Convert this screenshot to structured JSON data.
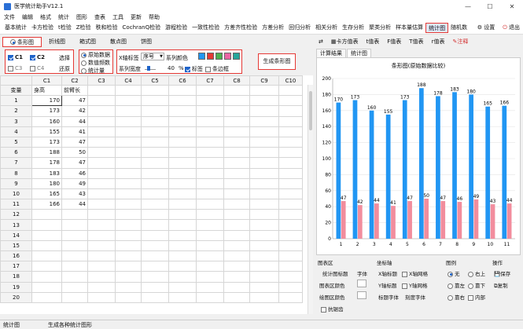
{
  "title": "医学统计助手V12.1",
  "menu": [
    "文件",
    "编辑",
    "格式",
    "统计",
    "图形",
    "查表",
    "工具",
    "更新",
    "帮助"
  ],
  "toolbar": [
    "基本统计",
    "卡方检验",
    "t检验",
    "Z检验",
    "秩和检验",
    "CochranQ检验",
    "游程检验",
    "一致性检验",
    "方差齐性检验",
    "方差分析",
    "回归分析",
    "相关分析",
    "生存分析",
    "聚类分析",
    "样本量估算",
    "统计图",
    "随机数"
  ],
  "toolbar_right": {
    "settings": "设置",
    "exit": "退出"
  },
  "chart_tabs": {
    "items": [
      "条形图",
      "折线图",
      "箱式图",
      "散点图",
      "饼图"
    ]
  },
  "cols": {
    "c1": "C1",
    "c2": "C2",
    "c3": "C3",
    "c4": "C4",
    "select": "选择",
    "restore": "还原"
  },
  "data_src": {
    "a": "原始数据",
    "b": "数值频数",
    "c": "统计量"
  },
  "xlabel": {
    "label": "X轴标签",
    "value": "序号",
    "series_color": "系列颜色",
    "width_label": "系列宽度",
    "width_value": "40",
    "pct": "%",
    "tag": "标签",
    "striped": "条边框"
  },
  "gen_button": "生成条形图",
  "colors": {
    "blue": "#2196f3",
    "pink": "#f28d9d",
    "sw1": "#2196f3",
    "sw2": "#e53935",
    "sw3": "#4caf50",
    "sw4": "#ec64a4",
    "sw5": "#26a69a"
  },
  "grid": {
    "headers": [
      "",
      "C1",
      "C2",
      "C3",
      "C4",
      "C5",
      "C6",
      "C7",
      "C8",
      "C9",
      "C10"
    ],
    "row1": [
      "变量",
      "身高",
      "前臂长"
    ],
    "rows": [
      [
        "1",
        "170",
        "47"
      ],
      [
        "2",
        "173",
        "42"
      ],
      [
        "3",
        "160",
        "44"
      ],
      [
        "4",
        "155",
        "41"
      ],
      [
        "5",
        "173",
        "47"
      ],
      [
        "6",
        "188",
        "50"
      ],
      [
        "7",
        "178",
        "47"
      ],
      [
        "8",
        "183",
        "46"
      ],
      [
        "9",
        "180",
        "49"
      ],
      [
        "10",
        "165",
        "43"
      ],
      [
        "11",
        "166",
        "44"
      ],
      [
        "12",
        "",
        ""
      ],
      [
        "13",
        "",
        ""
      ],
      [
        "14",
        "",
        ""
      ],
      [
        "15",
        "",
        ""
      ],
      [
        "16",
        "",
        ""
      ],
      [
        "17",
        "",
        ""
      ],
      [
        "18",
        "",
        ""
      ],
      [
        "19",
        "",
        ""
      ],
      [
        "20",
        "",
        ""
      ]
    ]
  },
  "status": {
    "left": "统计图",
    "msg": "生成各种统计图形"
  },
  "right_tabs": [
    "卡方值表",
    "t值表",
    "F值表",
    "T值表",
    "r值表",
    "注释"
  ],
  "sub_tabs": [
    "计算结果",
    "统计图"
  ],
  "chart_data": {
    "type": "bar",
    "title": "条形图(原始数据比较)",
    "categories": [
      "1",
      "2",
      "3",
      "4",
      "5",
      "6",
      "7",
      "8",
      "9",
      "10",
      "11"
    ],
    "series": [
      {
        "values": [
          170,
          173,
          160,
          155,
          173,
          188,
          178,
          183,
          180,
          165,
          166
        ]
      },
      {
        "values": [
          47,
          42,
          44,
          41,
          47,
          50,
          47,
          46,
          49,
          43,
          44
        ]
      }
    ],
    "ylim": [
      0,
      200
    ],
    "yticks": [
      0,
      20,
      40,
      60,
      80,
      100,
      120,
      140,
      160,
      180,
      200
    ],
    "grid": true
  },
  "panel": {
    "area": "图表区",
    "title_label": "统计图标题",
    "font": "字体",
    "area_color": "图表区颜色",
    "plot_color": "绘图区颜色",
    "smooth": "抗锯齿",
    "coord": "坐标轴",
    "xtitle": "X轴标题",
    "ytitle": "Y轴标题",
    "xgrid": "X轴网格",
    "ygrid": "Y轴网格",
    "title_font": "标题字体",
    "tick_font": "刻度字体",
    "legend": "图例",
    "none": "无",
    "top_right": "右上",
    "left": "靠左",
    "bottom_right": "靠下",
    "right": "靠右",
    "inside": "内部",
    "ops": "操作",
    "save": "保存",
    "copy": "复制"
  }
}
